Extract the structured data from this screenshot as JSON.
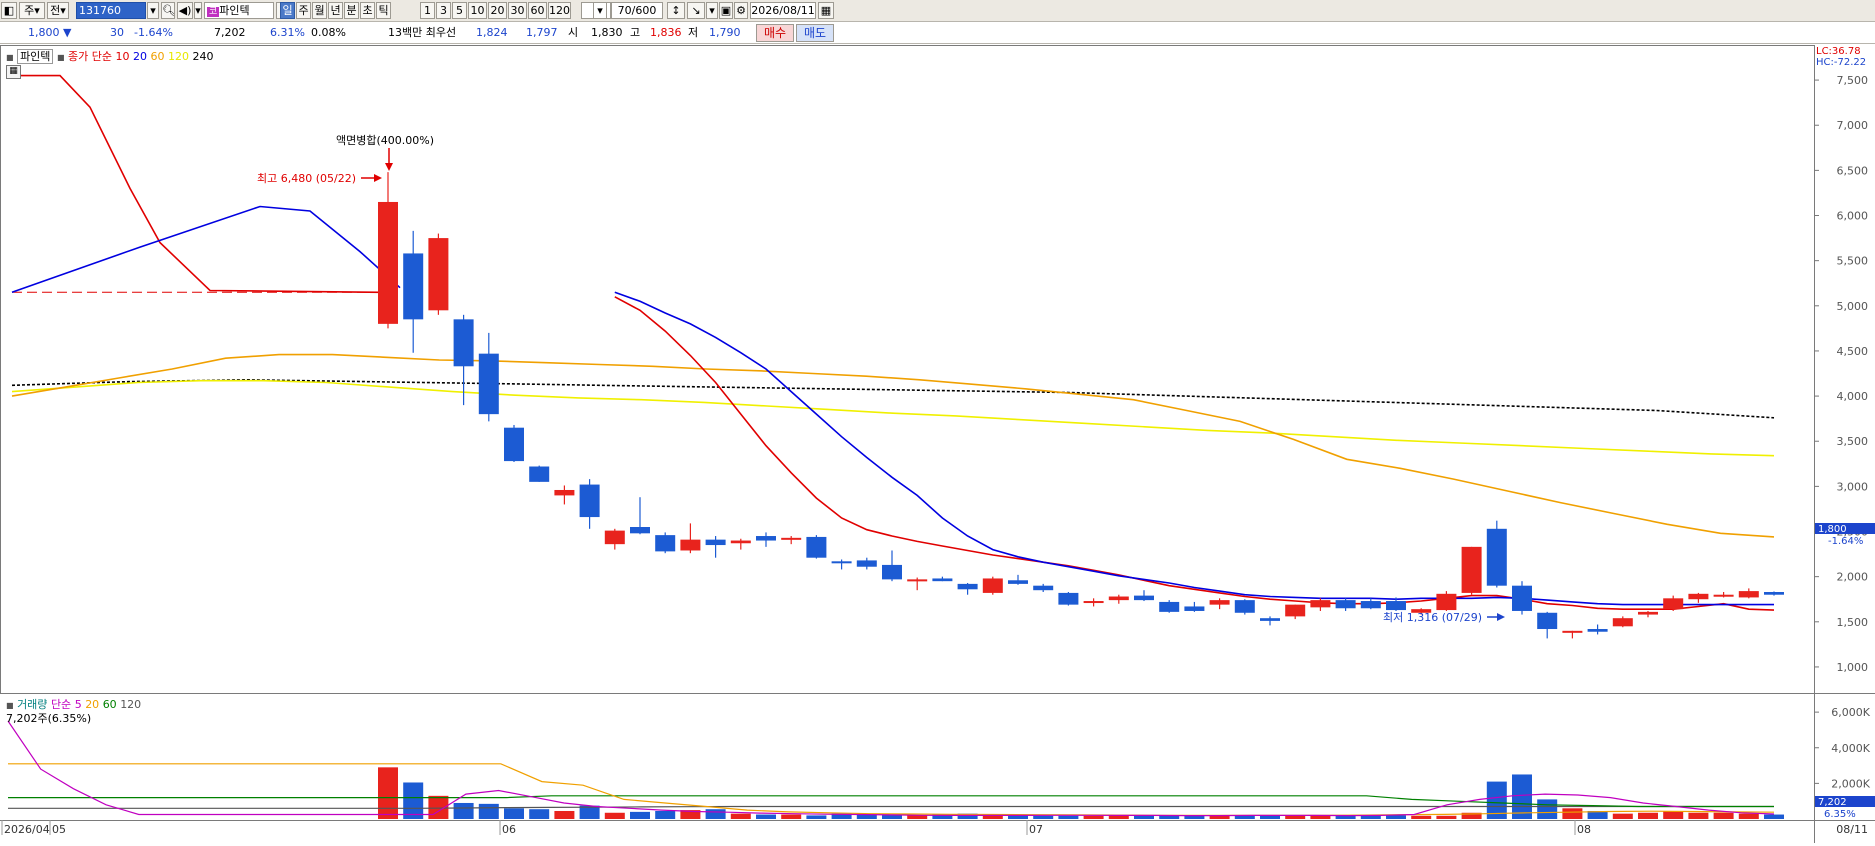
{
  "toolbar": {
    "type_select": "주",
    "scope": "전",
    "code": "131760",
    "stock_name": "파인텍",
    "periods": [
      "일",
      "주",
      "월",
      "년",
      "분",
      "초",
      "틱"
    ],
    "active_period": "일",
    "minutes": [
      "1",
      "3",
      "5",
      "10",
      "20",
      "30",
      "60",
      "120"
    ],
    "count": "70",
    "count_total": "/600",
    "date": "2026/08/11"
  },
  "quote": {
    "price": "1,800",
    "change_arrow": "▼",
    "change": "30",
    "change_pct": "-1.64%",
    "volume": "7,202",
    "volume_pct": "6.31%",
    "turnover": "0.08%",
    "note": "13백만 최우선",
    "ask": "1,824",
    "bid": "1,797",
    "open_label": "시",
    "open": "1,830",
    "high_label": "고",
    "high": "1,836",
    "low_label": "저",
    "low": "1,790",
    "buy_label": "매수",
    "sell_label": "매도"
  },
  "price_panel": {
    "name": "파인텍",
    "ma_title": "종가 단순",
    "ma_periods": [
      "10",
      "20",
      "60",
      "120",
      "240"
    ],
    "ma_colors": [
      "#e00000",
      "#0000e0",
      "#f0a000",
      "#f0f000",
      "#000000"
    ],
    "lc": "LC:36.78",
    "hc": "HC:-72.22",
    "split_note": "액면병합(400.00%)",
    "high_note": "최고 6,480 (05/22)",
    "low_note": "최저 1,316 (07/29)",
    "price_tag": "1,800",
    "price_tag_pct": "-1.64%",
    "y_ticks": [
      "7,500",
      "7,000",
      "6,500",
      "6,000",
      "5,500",
      "5,000",
      "4,500",
      "4,000",
      "3,500",
      "3,000",
      "2,500",
      "2,000",
      "1,500",
      "1,000"
    ]
  },
  "volume_panel": {
    "title": "거래량",
    "ma_title": "단순",
    "ma_periods": [
      "5",
      "20",
      "60",
      "120"
    ],
    "info": "7,202주(6.35%)",
    "y_ticks": [
      "6,000K",
      "4,000K",
      "2,000K"
    ],
    "vol_tag": "7,202",
    "vol_tag_pct": "6.35%"
  },
  "x_axis": {
    "labels": [
      "2026/04",
      "05",
      "06",
      "07",
      "08"
    ],
    "end_label": "08/11"
  },
  "chart_data": {
    "type": "candlestick",
    "up_color": "#e8231d",
    "down_color": "#1c5bd3",
    "ylim": [
      800,
      7800
    ],
    "candles": [
      {
        "o": 4800,
        "h": 6480,
        "l": 4750,
        "c": 6150
      },
      {
        "o": 5580,
        "h": 5830,
        "l": 4480,
        "c": 4850
      },
      {
        "o": 4950,
        "h": 5800,
        "l": 4900,
        "c": 5750
      },
      {
        "o": 4850,
        "h": 4900,
        "l": 3900,
        "c": 4330
      },
      {
        "o": 4470,
        "h": 4700,
        "l": 3720,
        "c": 3800
      },
      {
        "o": 3650,
        "h": 3680,
        "l": 3270,
        "c": 3280
      },
      {
        "o": 3220,
        "h": 3230,
        "l": 3050,
        "c": 3050
      },
      {
        "o": 2900,
        "h": 3010,
        "l": 2800,
        "c": 2960
      },
      {
        "o": 3020,
        "h": 3080,
        "l": 2530,
        "c": 2660
      },
      {
        "o": 2360,
        "h": 2530,
        "l": 2300,
        "c": 2510
      },
      {
        "o": 2550,
        "h": 2880,
        "l": 2470,
        "c": 2480
      },
      {
        "o": 2460,
        "h": 2490,
        "l": 2260,
        "c": 2280
      },
      {
        "o": 2290,
        "h": 2590,
        "l": 2260,
        "c": 2410
      },
      {
        "o": 2410,
        "h": 2450,
        "l": 2210,
        "c": 2350
      },
      {
        "o": 2370,
        "h": 2420,
        "l": 2300,
        "c": 2400
      },
      {
        "o": 2450,
        "h": 2490,
        "l": 2330,
        "c": 2400
      },
      {
        "o": 2410,
        "h": 2450,
        "l": 2360,
        "c": 2430
      },
      {
        "o": 2440,
        "h": 2460,
        "l": 2200,
        "c": 2210
      },
      {
        "o": 2170,
        "h": 2190,
        "l": 2080,
        "c": 2150
      },
      {
        "o": 2180,
        "h": 2210,
        "l": 2080,
        "c": 2110
      },
      {
        "o": 2130,
        "h": 2290,
        "l": 1950,
        "c": 1970
      },
      {
        "o": 1960,
        "h": 1990,
        "l": 1850,
        "c": 1970
      },
      {
        "o": 1980,
        "h": 2000,
        "l": 1950,
        "c": 1950
      },
      {
        "o": 1920,
        "h": 1930,
        "l": 1800,
        "c": 1860
      },
      {
        "o": 1820,
        "h": 2000,
        "l": 1800,
        "c": 1980
      },
      {
        "o": 1960,
        "h": 2020,
        "l": 1910,
        "c": 1920
      },
      {
        "o": 1900,
        "h": 1920,
        "l": 1830,
        "c": 1850
      },
      {
        "o": 1820,
        "h": 1830,
        "l": 1680,
        "c": 1690
      },
      {
        "o": 1710,
        "h": 1760,
        "l": 1670,
        "c": 1730
      },
      {
        "o": 1740,
        "h": 1800,
        "l": 1700,
        "c": 1780
      },
      {
        "o": 1790,
        "h": 1850,
        "l": 1730,
        "c": 1740
      },
      {
        "o": 1720,
        "h": 1740,
        "l": 1600,
        "c": 1610
      },
      {
        "o": 1670,
        "h": 1720,
        "l": 1610,
        "c": 1620
      },
      {
        "o": 1690,
        "h": 1760,
        "l": 1640,
        "c": 1740
      },
      {
        "o": 1740,
        "h": 1750,
        "l": 1580,
        "c": 1600
      },
      {
        "o": 1540,
        "h": 1560,
        "l": 1460,
        "c": 1510
      },
      {
        "o": 1560,
        "h": 1690,
        "l": 1530,
        "c": 1690
      },
      {
        "o": 1660,
        "h": 1760,
        "l": 1620,
        "c": 1740
      },
      {
        "o": 1740,
        "h": 1760,
        "l": 1620,
        "c": 1650
      },
      {
        "o": 1730,
        "h": 1760,
        "l": 1640,
        "c": 1650
      },
      {
        "o": 1730,
        "h": 1770,
        "l": 1620,
        "c": 1630
      },
      {
        "o": 1600,
        "h": 1650,
        "l": 1580,
        "c": 1640
      },
      {
        "o": 1630,
        "h": 1840,
        "l": 1620,
        "c": 1810
      },
      {
        "o": 1820,
        "h": 2330,
        "l": 1800,
        "c": 2330
      },
      {
        "o": 2530,
        "h": 2620,
        "l": 1880,
        "c": 1900
      },
      {
        "o": 1900,
        "h": 1950,
        "l": 1580,
        "c": 1620
      },
      {
        "o": 1600,
        "h": 1610,
        "l": 1316,
        "c": 1420
      },
      {
        "o": 1380,
        "h": 1400,
        "l": 1316,
        "c": 1400
      },
      {
        "o": 1420,
        "h": 1470,
        "l": 1360,
        "c": 1390
      },
      {
        "o": 1450,
        "h": 1560,
        "l": 1440,
        "c": 1540
      },
      {
        "o": 1580,
        "h": 1620,
        "l": 1550,
        "c": 1610
      },
      {
        "o": 1640,
        "h": 1790,
        "l": 1620,
        "c": 1760
      },
      {
        "o": 1750,
        "h": 1820,
        "l": 1710,
        "c": 1810
      },
      {
        "o": 1790,
        "h": 1830,
        "l": 1770,
        "c": 1800
      },
      {
        "o": 1770,
        "h": 1870,
        "l": 1760,
        "c": 1840
      },
      {
        "o": 1830,
        "h": 1836,
        "l": 1790,
        "c": 1800
      }
    ],
    "ma10": [
      5150,
      5150,
      5150,
      5150,
      5150,
      5150,
      5150,
      5150,
      5150,
      5100,
      4950,
      4720,
      4450,
      4150,
      3800,
      3450,
      3150,
      2870,
      2650,
      2520,
      2450,
      2390,
      2340,
      2290,
      2240,
      2200,
      2160,
      2120,
      2070,
      2020,
      1960,
      1900,
      1860,
      1820,
      1780,
      1750,
      1730,
      1710,
      1700,
      1700,
      1710,
      1730,
      1760,
      1790,
      1790,
      1750,
      1700,
      1680,
      1650,
      1640,
      1640,
      1640,
      1670,
      1700,
      1640,
      1630
    ],
    "ma20": [
      5150,
      5400,
      5750,
      6050,
      6100,
      6050,
      5900,
      5500,
      5200,
      5150,
      5050,
      4920,
      4800,
      4650,
      4480,
      4300,
      4050,
      3800,
      3550,
      3320,
      3100,
      2900,
      2650,
      2450,
      2300,
      2220,
      2160,
      2110,
      2060,
      2010,
      1970,
      1930,
      1880,
      1840,
      1800,
      1780,
      1770,
      1760,
      1760,
      1760,
      1750,
      1760,
      1760,
      1760,
      1770,
      1760,
      1740,
      1720,
      1700,
      1690,
      1690,
      1690,
      1690,
      1690,
      1690,
      1690
    ],
    "ma60": [
      4000,
      4100,
      4200,
      4300,
      4420,
      4460,
      4460,
      4430,
      4400,
      4390,
      4370,
      4350,
      4330,
      4300,
      4280,
      4250,
      4220,
      4180,
      4130,
      4080,
      4020,
      3960,
      3840,
      3720,
      3520,
      3300,
      3200,
      3080,
      2950,
      2820,
      2700,
      2580,
      2480,
      2440
    ],
    "ma120": [
      4050,
      4100,
      4150,
      4170,
      4170,
      4150,
      4100,
      4050,
      4010,
      3980,
      3960,
      3930,
      3890,
      3850,
      3810,
      3780,
      3740,
      3700,
      3660,
      3620,
      3590,
      3550,
      3510,
      3480,
      3450,
      3420,
      3390,
      3360,
      3340
    ],
    "ma240": [
      4120,
      4140,
      4160,
      4170,
      4180,
      4170,
      4160,
      4150,
      4140,
      4130,
      4120,
      4110,
      4100,
      4090,
      4080,
      4070,
      4060,
      4050,
      4040,
      4020,
      4000,
      3980,
      3960,
      3940,
      3920,
      3900,
      3880,
      3860,
      3840,
      3800,
      3760
    ],
    "volume": [
      2900,
      2050,
      1300,
      900,
      850,
      600,
      550,
      450,
      750,
      350,
      400,
      450,
      500,
      550,
      300,
      250,
      250,
      200,
      300,
      250,
      250,
      200,
      250,
      300,
      200,
      200,
      180,
      180,
      180,
      200,
      200,
      220,
      200,
      180,
      180,
      220,
      200,
      180,
      220,
      200,
      200,
      180,
      180,
      350,
      2100,
      2500,
      1100,
      600,
      450,
      300,
      350,
      420,
      350,
      350,
      300,
      250
    ],
    "volume_ylim": [
      0,
      6400
    ],
    "vol_ma5": [
      5500,
      2800,
      1700,
      800,
      250,
      250,
      250,
      250,
      250,
      250,
      250,
      250,
      250,
      250,
      1400,
      1600,
      1250,
      900,
      700,
      600,
      500,
      420,
      380,
      330,
      300,
      270,
      250,
      230,
      210,
      200,
      200,
      200,
      210,
      210,
      200,
      200,
      190,
      190,
      200,
      200,
      200,
      190,
      200,
      250,
      800,
      1100,
      1300,
      1400,
      1350,
      1200,
      900,
      700,
      500,
      350,
      280
    ],
    "vol_ma20": [
      3100,
      3100,
      3100,
      3100,
      3100,
      3100,
      3100,
      3100,
      3100,
      3100,
      3100,
      3100,
      3100,
      2100,
      1900,
      1100,
      900,
      700,
      500,
      400,
      350,
      300,
      280,
      260,
      250,
      240,
      230,
      220,
      210,
      210,
      210,
      210,
      210,
      220,
      240,
      260,
      300,
      350,
      380,
      420,
      440,
      420,
      400,
      380
    ],
    "vol_ma60": [
      1200,
      1200,
      1200,
      1200,
      1200,
      1200,
      1200,
      1200,
      1200,
      1200,
      1200,
      1200,
      1300,
      1300,
      1300,
      1300,
      1300,
      1300,
      1300,
      1300,
      1300,
      1300,
      1300,
      1300,
      1300,
      1300,
      1300,
      1300,
      1300,
      1300,
      1300,
      1100,
      1000,
      900,
      800,
      750,
      700,
      700,
      700,
      700
    ],
    "vol_ma120": [
      600,
      600,
      600,
      600,
      600,
      600,
      600,
      600,
      600,
      600,
      620,
      640,
      650,
      660,
      680,
      690,
      700,
      700,
      700,
      700,
      700,
      700,
      700,
      700,
      700,
      700,
      700,
      700,
      700,
      700,
      700,
      700,
      700,
      700,
      700,
      700,
      700,
      700,
      700,
      700
    ]
  }
}
